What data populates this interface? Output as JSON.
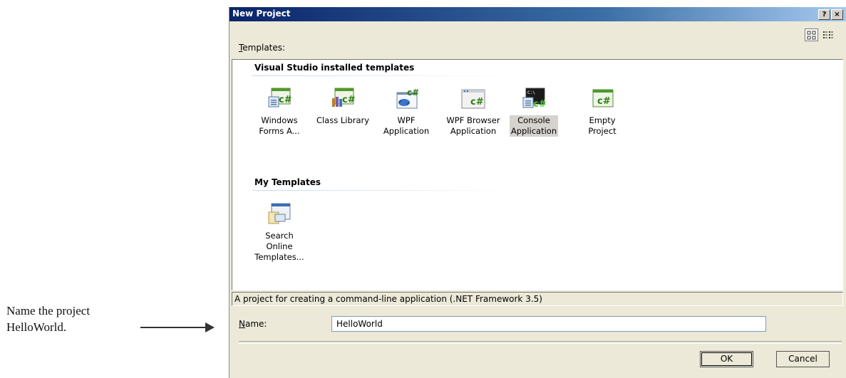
{
  "annotation": {
    "line1": "Name the project",
    "line2": "HelloWorld."
  },
  "dialog": {
    "title": "New Project",
    "help_glyph": "?",
    "close_glyph": "×",
    "templates_label_u": "T",
    "templates_label_rest": "emplates:",
    "groups": {
      "installed": "Visual Studio installed templates",
      "my": "My Templates"
    },
    "installed_templates": [
      {
        "line1": "Windows",
        "line2": "Forms A...",
        "icon": "windows-forms-icon"
      },
      {
        "line1": "Class Library",
        "line2": "",
        "icon": "class-library-icon"
      },
      {
        "line1": "WPF",
        "line2": "Application",
        "icon": "wpf-application-icon"
      },
      {
        "line1": "WPF Browser",
        "line2": "Application",
        "icon": "wpf-browser-icon"
      },
      {
        "line1": "Console",
        "line2": "Application",
        "icon": "console-application-icon",
        "selected": true
      },
      {
        "line1": "Empty Project",
        "line2": "",
        "icon": "empty-project-icon"
      }
    ],
    "my_templates": [
      {
        "line1": "Search Online",
        "line2": "Templates...",
        "icon": "search-online-icon"
      }
    ],
    "description": "A project for creating a command-line application (.NET Framework 3.5)",
    "name_label_u": "N",
    "name_label_rest": "ame:",
    "name_value": "HelloWorld",
    "ok_label": "OK",
    "cancel_label": "Cancel",
    "colors": {
      "title_gradient_start": "#0a246a",
      "title_gradient_end": "#a6caf0",
      "dialog_face": "#ece9d8",
      "csharp_green": "#2f7d12"
    }
  }
}
